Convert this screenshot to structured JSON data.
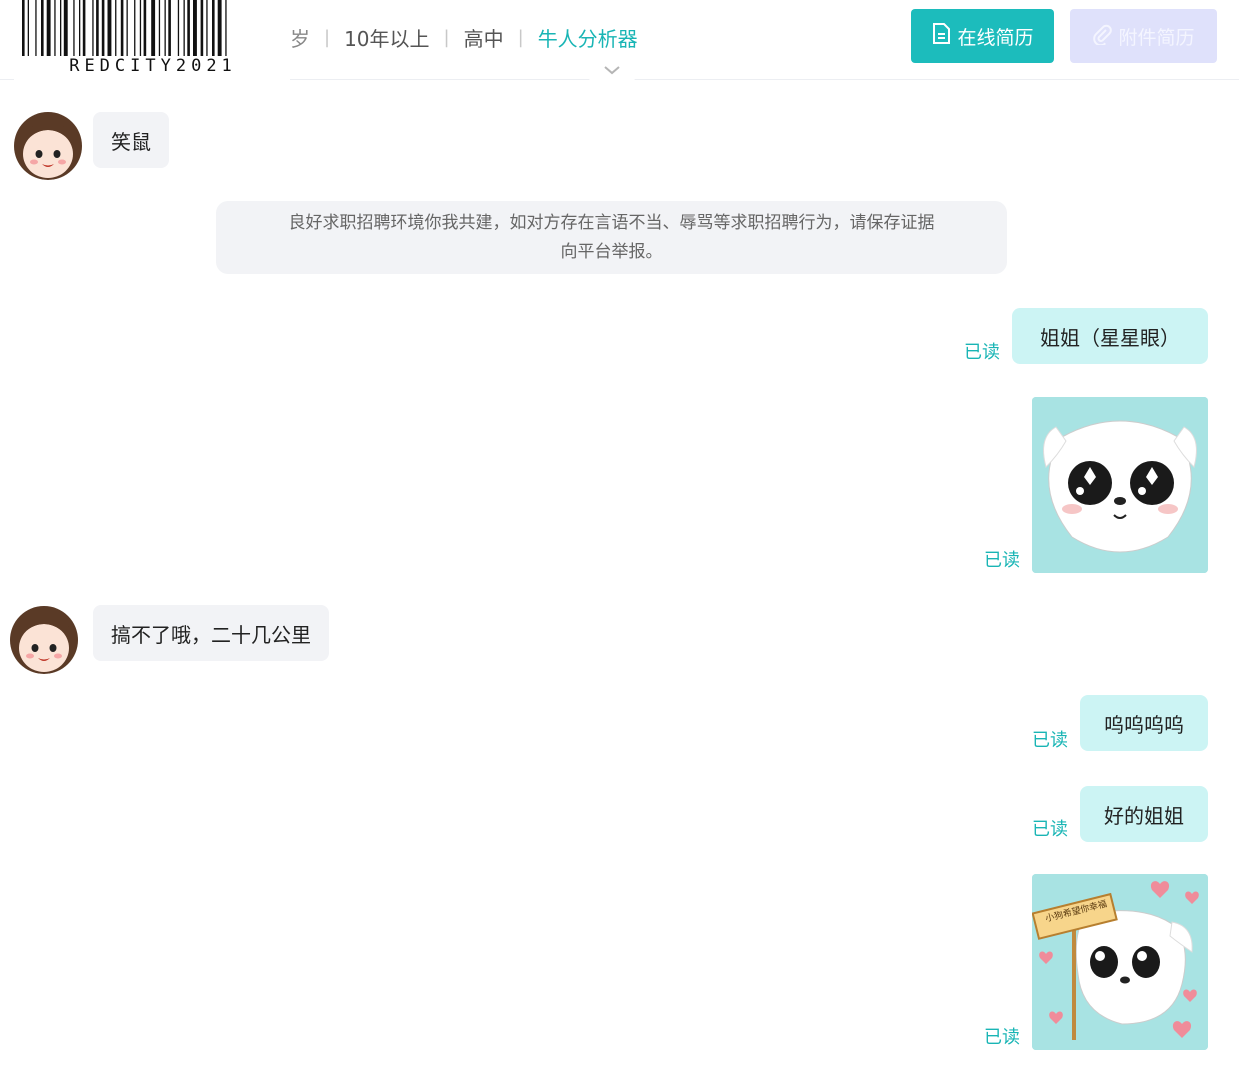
{
  "header": {
    "watermark_text": "REDCITY2021",
    "partial_text": "岁",
    "experience": "10年以上",
    "education": "高中",
    "analyzer_link": "牛人分析器",
    "online_resume_label": "在线简历",
    "attachment_resume_label": "附件简历"
  },
  "notice": {
    "line1": "良好求职招聘环境你我共建，如对方存在言语不当、辱骂等求职招聘行为，请保存证据",
    "line2": "向平台举报。"
  },
  "messages": [
    {
      "side": "left",
      "text": "笑鼠"
    },
    {
      "side": "right",
      "text": "姐姐（星星眼）",
      "status": "已读"
    },
    {
      "side": "right",
      "type": "sticker",
      "status": "已读"
    },
    {
      "side": "left",
      "text": "搞不了哦，二十几公里"
    },
    {
      "side": "right",
      "text": "呜呜呜呜",
      "status": "已读"
    },
    {
      "side": "right",
      "text": "好的姐姐",
      "status": "已读"
    },
    {
      "side": "right",
      "type": "sticker",
      "status": "已读",
      "sign_text": "小狗希望你幸福"
    }
  ],
  "colors": {
    "accent": "#1cbcbc",
    "sent_bubble": "#ccf4f4",
    "received_bubble": "#f2f3f6"
  }
}
